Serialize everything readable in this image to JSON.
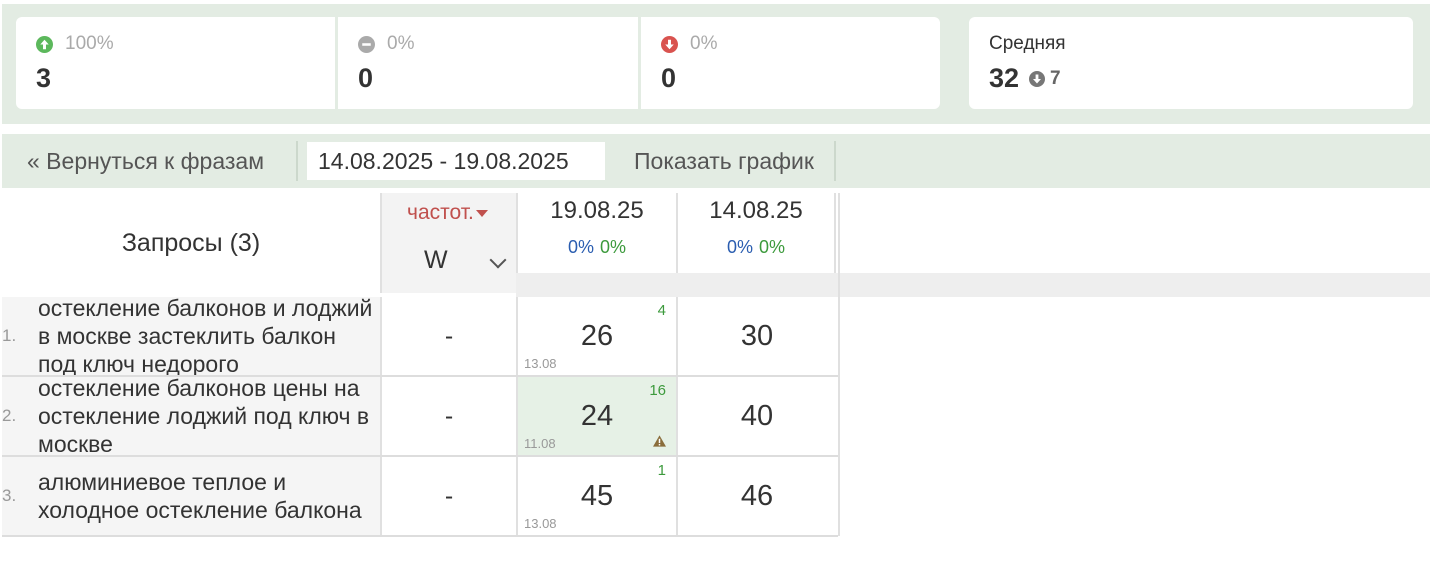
{
  "stats": {
    "up": {
      "percent": "100%",
      "count": "3",
      "icon": "arrow-up-circle-icon",
      "color": "#5cb85c"
    },
    "same": {
      "percent": "0%",
      "count": "0",
      "icon": "minus-circle-icon",
      "color": "#aaaaaa"
    },
    "down": {
      "percent": "0%",
      "count": "0",
      "icon": "arrow-down-circle-icon",
      "color": "#d9534f"
    },
    "average": {
      "title": "Средняя",
      "value": "32",
      "delta": "7",
      "delta_icon": "arrow-down-circle-icon"
    }
  },
  "toolbar": {
    "back_label": "« Вернуться к фразам",
    "date_range": "14.08.2025 - 19.08.2025",
    "chart_label": "Показать график"
  },
  "table": {
    "query_header": "Запросы (3)",
    "freq_header": "частот.",
    "freq_select": "W",
    "dates": [
      {
        "date": "19.08.25",
        "pct_blue": "0%",
        "pct_green": "0%"
      },
      {
        "date": "14.08.25",
        "pct_blue": "0%",
        "pct_green": "0%"
      }
    ],
    "rows": [
      {
        "num": "1.",
        "query": "остекление балконов и лоджий в москве застеклить балкон под ключ недорого",
        "freq": "-",
        "pos_current": "26",
        "change": "4",
        "prev_date": "13.08",
        "pos_old": "30",
        "highlight": false,
        "warning": false
      },
      {
        "num": "2.",
        "query": "остекление балконов цены на остекление лоджий под ключ в москве",
        "freq": "-",
        "pos_current": "24",
        "change": "16",
        "prev_date": "11.08",
        "pos_old": "40",
        "highlight": true,
        "warning": true
      },
      {
        "num": "3.",
        "query": "алюминиевое теплое и холодное остекление балкона",
        "freq": "-",
        "pos_current": "45",
        "change": "1",
        "prev_date": "13.08",
        "pos_old": "46",
        "highlight": false,
        "warning": false
      }
    ]
  }
}
